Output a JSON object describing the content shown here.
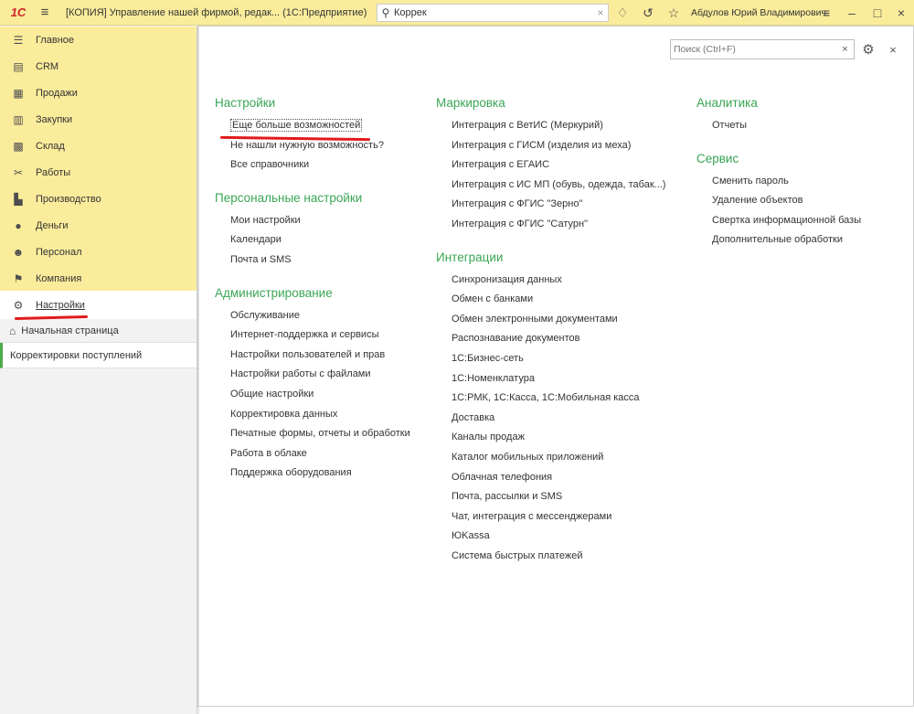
{
  "titlebar": {
    "logo": "1С",
    "title": "[КОПИЯ] Управление нашей фирмой, редак...  (1С:Предприятие)",
    "search_value": "Коррек",
    "username": "Абдулов Юрий Владимирович"
  },
  "sidebar": {
    "items": [
      {
        "label": "Главное",
        "icon": "menu-lines-icon"
      },
      {
        "label": "CRM",
        "icon": "crm-card-icon"
      },
      {
        "label": "Продажи",
        "icon": "basket-icon"
      },
      {
        "label": "Закупки",
        "icon": "cart-icon"
      },
      {
        "label": "Склад",
        "icon": "warehouse-grid-icon"
      },
      {
        "label": "Работы",
        "icon": "tools-icon"
      },
      {
        "label": "Производство",
        "icon": "factory-icon"
      },
      {
        "label": "Деньги",
        "icon": "coin-icon"
      },
      {
        "label": "Персонал",
        "icon": "people-icon"
      },
      {
        "label": "Компания",
        "icon": "flag-icon"
      },
      {
        "label": "Настройки",
        "icon": "gear-icon"
      }
    ],
    "home_label": "Начальная страница",
    "open_window": "Корректировки поступлений"
  },
  "main": {
    "search_placeholder": "Поиск (Ctrl+F)",
    "col1": {
      "sections": [
        {
          "title": "Настройки",
          "links": [
            "Еще больше возможностей",
            "Не нашли нужную возможность?",
            "Все справочники"
          ]
        },
        {
          "title": "Персональные настройки",
          "links": [
            "Мои настройки",
            "Календари",
            "Почта и SMS"
          ]
        },
        {
          "title": "Администрирование",
          "links": [
            "Обслуживание",
            "Интернет-поддержка и сервисы",
            "Настройки пользователей и прав",
            "Настройки работы с файлами",
            "Общие настройки",
            "Корректировка данных",
            "Печатные формы, отчеты и обработки",
            "Работа в облаке",
            "Поддержка оборудования"
          ]
        }
      ]
    },
    "col2": {
      "sections": [
        {
          "title": "Маркировка",
          "links": [
            "Интеграция с ВетИС (Меркурий)",
            "Интеграция с ГИСМ (изделия из меха)",
            "Интеграция с ЕГАИС",
            "Интеграция с ИС МП (обувь, одежда, табак...)",
            "Интеграция с ФГИС \"Зерно\"",
            "Интеграция с ФГИС \"Сатурн\""
          ]
        },
        {
          "title": "Интеграции",
          "links": [
            "Синхронизация данных",
            "Обмен с банками",
            "Обмен электронными документами",
            "Распознавание документов",
            "1С:Бизнес-сеть",
            "1С:Номенклатура",
            "1С:РМК, 1С:Касса, 1С:Мобильная касса",
            "Доставка",
            "Каналы продаж",
            "Каталог мобильных приложений",
            "Облачная телефония",
            "Почта, рассылки и SMS",
            "Чат, интеграция с мессенджерами",
            "ЮKassa",
            "Система быстрых платежей"
          ]
        }
      ]
    },
    "col3": {
      "sections": [
        {
          "title": "Аналитика",
          "links": [
            "Отчеты"
          ]
        },
        {
          "title": "Сервис",
          "links": [
            "Сменить пароль",
            "Удаление объектов",
            "Свертка информационной базы",
            "Дополнительные обработки"
          ]
        }
      ]
    }
  },
  "colors": {
    "accent_green": "#3aa655",
    "sidebar_yellow": "#fbec9c",
    "annotation_red": "#e21a1a"
  }
}
